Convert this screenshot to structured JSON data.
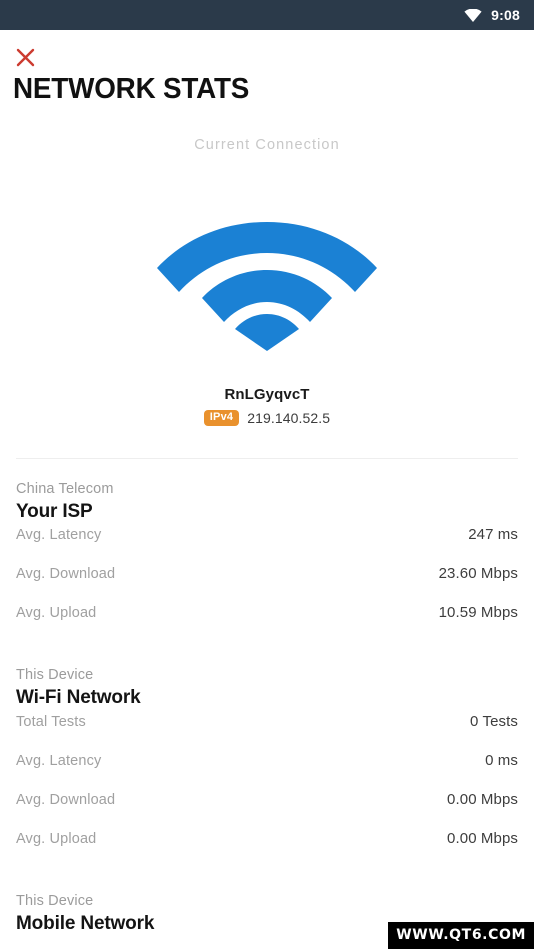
{
  "status_bar": {
    "wifi_icon": "wifi-icon",
    "time": "9:08",
    "background_color": "#2b3a4a",
    "foreground_color": "#ffffff"
  },
  "header": {
    "close_icon": "close-x-icon",
    "close_color": "#cc3b30",
    "title": "NETWORK STATS"
  },
  "connection": {
    "label": "Current Connection",
    "wifi_icon": "wifi-signal-icon",
    "wifi_color": "#1b81d4",
    "ssid": "RnLGyqvcT",
    "ip_badge": "IPv4",
    "ip_badge_color": "#e9912d",
    "ip_address": "219.140.52.5"
  },
  "sections": [
    {
      "subtitle": "China Telecom",
      "title": "Your ISP",
      "rows": [
        {
          "label": "Avg. Latency",
          "value": "247 ms"
        },
        {
          "label": "Avg. Download",
          "value": "23.60 Mbps"
        },
        {
          "label": "Avg. Upload",
          "value": "10.59 Mbps"
        }
      ]
    },
    {
      "subtitle": "This Device",
      "title": "Wi-Fi Network",
      "rows": [
        {
          "label": "Total Tests",
          "value": "0 Tests"
        },
        {
          "label": "Avg. Latency",
          "value": "0 ms"
        },
        {
          "label": "Avg. Download",
          "value": "0.00 Mbps"
        },
        {
          "label": "Avg. Upload",
          "value": "0.00 Mbps"
        }
      ]
    },
    {
      "subtitle": "This Device",
      "title": "Mobile Network",
      "rows": []
    }
  ],
  "watermark": {
    "text": "WWW.QT6.COM"
  }
}
